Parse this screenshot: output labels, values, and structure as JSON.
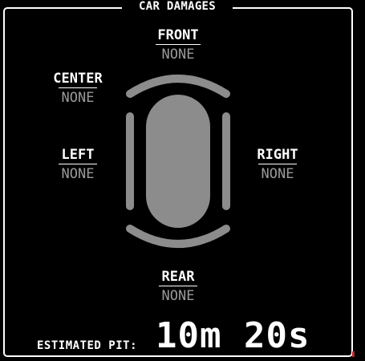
{
  "panel": {
    "title": "CAR DAMAGES"
  },
  "zones": {
    "front": {
      "label": "FRONT",
      "value": "NONE"
    },
    "center": {
      "label": "CENTER",
      "value": "NONE"
    },
    "left": {
      "label": "LEFT",
      "value": "NONE"
    },
    "right": {
      "label": "RIGHT",
      "value": "NONE"
    },
    "rear": {
      "label": "REAR",
      "value": "NONE"
    }
  },
  "pit": {
    "label": "ESTIMATED PIT:",
    "value": "10m 20s"
  },
  "colors": {
    "background": "#000000",
    "text": "#ffffff",
    "value_text": "#9a9a9a",
    "car_body": "#8c8c8c",
    "accent": "#c0202a"
  }
}
